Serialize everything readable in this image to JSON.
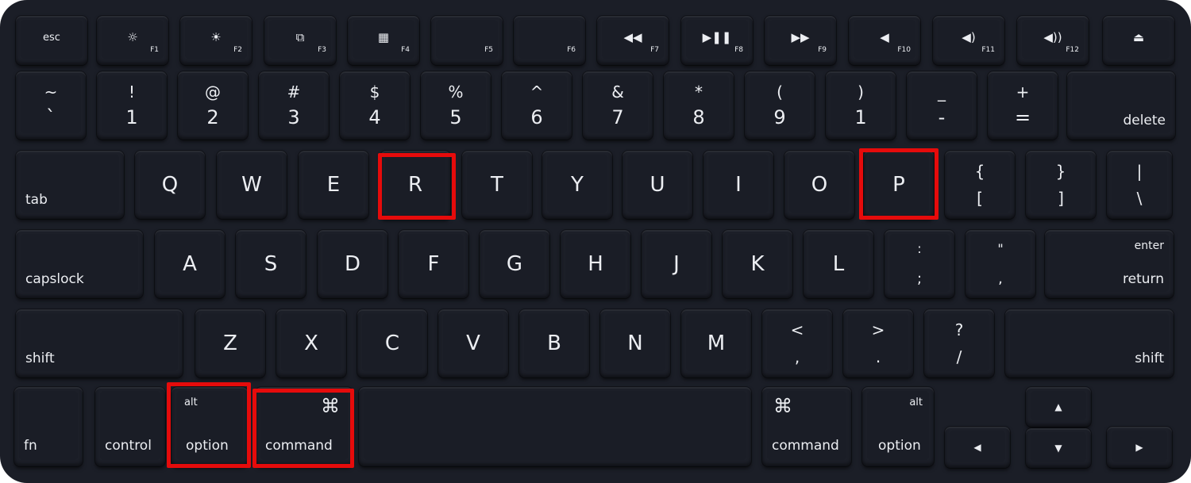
{
  "keyboard": {
    "function_row": [
      {
        "id": "esc",
        "label": "esc"
      },
      {
        "id": "f1",
        "icon": "brightness-down-icon",
        "glyph": "☼",
        "label": "F1"
      },
      {
        "id": "f2",
        "icon": "brightness-up-icon",
        "glyph": "☀",
        "label": "F2"
      },
      {
        "id": "f3",
        "icon": "mission-control-icon",
        "glyph": "⧉",
        "label": "F3"
      },
      {
        "id": "f4",
        "icon": "launchpad-icon",
        "glyph": "▦",
        "label": "F4"
      },
      {
        "id": "f5",
        "label": "F5"
      },
      {
        "id": "f6",
        "label": "F6"
      },
      {
        "id": "f7",
        "icon": "rewind-icon",
        "glyph": "◀◀",
        "label": "F7"
      },
      {
        "id": "f8",
        "icon": "play-pause-icon",
        "glyph": "▶❚❚",
        "label": "F8"
      },
      {
        "id": "f9",
        "icon": "fast-forward-icon",
        "glyph": "▶▶",
        "label": "F9"
      },
      {
        "id": "f10",
        "icon": "mute-icon",
        "glyph": "◀",
        "label": "F10"
      },
      {
        "id": "f11",
        "icon": "volume-down-icon",
        "glyph": "◀)",
        "label": "F11"
      },
      {
        "id": "f12",
        "icon": "volume-up-icon",
        "glyph": "◀))",
        "label": "F12"
      },
      {
        "id": "eject",
        "icon": "eject-icon",
        "glyph": "⏏"
      }
    ],
    "number_row": [
      {
        "top": "~",
        "bottom": "`"
      },
      {
        "top": "!",
        "bottom": "1"
      },
      {
        "top": "@",
        "bottom": "2"
      },
      {
        "top": "#",
        "bottom": "3"
      },
      {
        "top": "$",
        "bottom": "4"
      },
      {
        "top": "%",
        "bottom": "5"
      },
      {
        "top": "^",
        "bottom": "6"
      },
      {
        "top": "&",
        "bottom": "7"
      },
      {
        "top": "*",
        "bottom": "8"
      },
      {
        "top": "(",
        "bottom": "9"
      },
      {
        "top": ")",
        "bottom": "1"
      },
      {
        "top": "_",
        "bottom": "-"
      },
      {
        "top": "+",
        "bottom": "="
      },
      {
        "label": "delete"
      }
    ],
    "qwerty_row": {
      "tab": "tab",
      "letters": [
        "Q",
        "W",
        "E",
        "R",
        "T",
        "Y",
        "U",
        "I",
        "O",
        "P"
      ],
      "symbols": [
        {
          "top": "{",
          "bottom": "["
        },
        {
          "top": "}",
          "bottom": "]"
        },
        {
          "top": "|",
          "bottom": "\\"
        }
      ]
    },
    "home_row": {
      "capslock": "capslock",
      "letters": [
        "A",
        "S",
        "D",
        "F",
        "G",
        "H",
        "J",
        "K",
        "L"
      ],
      "symbols": [
        {
          "top": ":",
          "bottom": ";"
        },
        {
          "top": "\"",
          "bottom": ","
        }
      ],
      "enter_top": "enter",
      "enter_bottom": "return"
    },
    "shift_row": {
      "shift_left": "shift",
      "letters": [
        "Z",
        "X",
        "C",
        "V",
        "B",
        "N",
        "M"
      ],
      "symbols": [
        {
          "top": "<",
          "bottom": ","
        },
        {
          "top": ">",
          "bottom": "."
        },
        {
          "top": "?",
          "bottom": "/"
        }
      ],
      "shift_right": "shift"
    },
    "bottom_row": {
      "fn": "fn",
      "control": "control",
      "option_left": {
        "top": "alt",
        "bottom": "option"
      },
      "command_left": {
        "top": "⌘",
        "bottom": "command"
      },
      "command_right": {
        "top": "⌘",
        "bottom": "command"
      },
      "option_right": {
        "top": "alt",
        "bottom": "option"
      },
      "arrows": {
        "up": "▲",
        "down": "▼",
        "left": "◀",
        "right": "▶"
      }
    },
    "highlighted_keys": [
      "R",
      "P",
      "option",
      "command"
    ],
    "highlight_color": "#e60b0b"
  }
}
